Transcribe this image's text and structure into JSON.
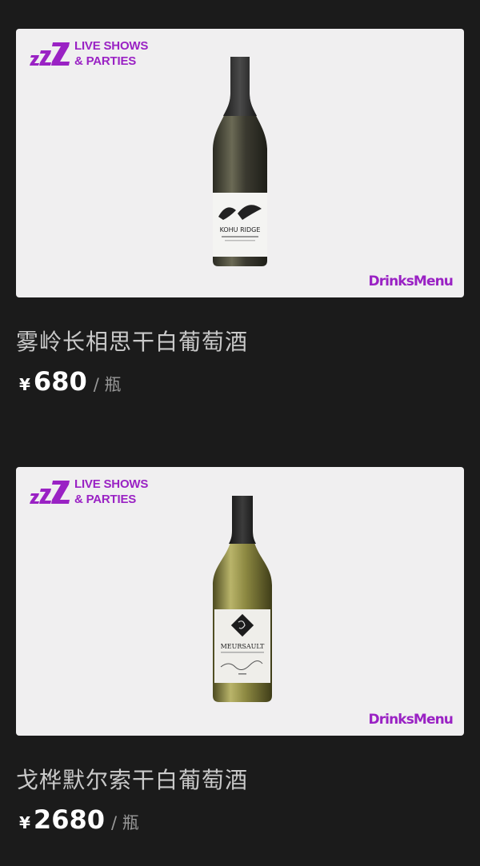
{
  "products": [
    {
      "brand_line1": "LIVE SHOWS",
      "brand_line2": "& PARTIES",
      "menu_logo": "DrinksMenu",
      "label_text": "KOHU RIDGE",
      "name": "雾岭长相思干白葡萄酒",
      "currency": "¥",
      "price": "680",
      "unit": "/ 瓶"
    },
    {
      "brand_line1": "LIVE SHOWS",
      "brand_line2": "& PARTIES",
      "menu_logo": "DrinksMenu",
      "label_text": "MEURSAULT",
      "name": "戈桦默尔索干白葡萄酒",
      "currency": "¥",
      "price": "2680",
      "unit": "/ 瓶"
    }
  ],
  "colors": {
    "background": "#1b1b1b",
    "panel": "#f0eff0",
    "brand_purple": "#9a22c4"
  },
  "icons": {
    "brand_mark": "zzz-logo-icon",
    "product_image": "wine-bottle-icon"
  }
}
